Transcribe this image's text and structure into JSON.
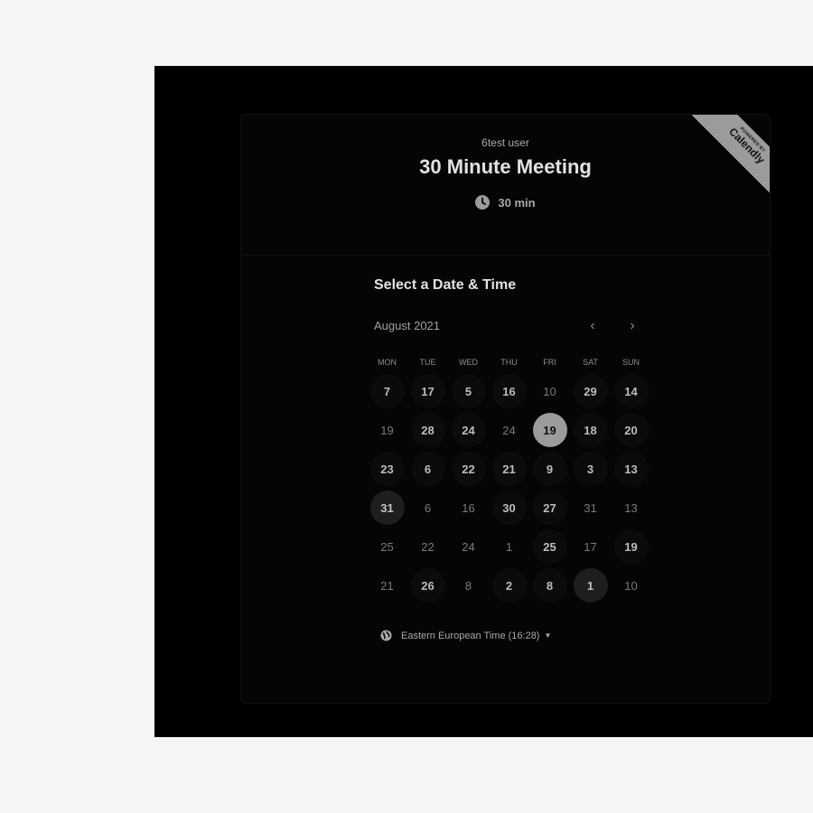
{
  "event": {
    "host": "6test user",
    "title": "30 Minute Meeting",
    "duration": "30 min"
  },
  "badge": {
    "top_text": "POWERED BY",
    "brand": "Calendly"
  },
  "picker": {
    "title": "Select a Date & Time",
    "month": "August 2021",
    "prev_icon": "chevron-left-icon",
    "next_icon": "chevron-right-icon",
    "weekdays": [
      "MON",
      "TUE",
      "WED",
      "THU",
      "FRI",
      "SAT",
      "SUN"
    ],
    "weeks": [
      [
        {
          "d": "7",
          "s": "avail"
        },
        {
          "d": "17",
          "s": "avail"
        },
        {
          "d": "5",
          "s": "avail"
        },
        {
          "d": "16",
          "s": "avail"
        },
        {
          "d": "10",
          "s": "off"
        },
        {
          "d": "29",
          "s": "avail"
        },
        {
          "d": "14",
          "s": "avail"
        }
      ],
      [
        {
          "d": "19",
          "s": "off"
        },
        {
          "d": "28",
          "s": "avail"
        },
        {
          "d": "24",
          "s": "avail"
        },
        {
          "d": "24",
          "s": "off"
        },
        {
          "d": "19",
          "s": "selected"
        },
        {
          "d": "18",
          "s": "avail"
        },
        {
          "d": "20",
          "s": "avail"
        }
      ],
      [
        {
          "d": "23",
          "s": "avail"
        },
        {
          "d": "6",
          "s": "avail"
        },
        {
          "d": "22",
          "s": "avail"
        },
        {
          "d": "21",
          "s": "avail"
        },
        {
          "d": "9",
          "s": "avail"
        },
        {
          "d": "3",
          "s": "avail"
        },
        {
          "d": "13",
          "s": "avail"
        }
      ],
      [
        {
          "d": "31",
          "s": "soft"
        },
        {
          "d": "6",
          "s": "off"
        },
        {
          "d": "16",
          "s": "off"
        },
        {
          "d": "30",
          "s": "avail"
        },
        {
          "d": "27",
          "s": "avail"
        },
        {
          "d": "31",
          "s": "off"
        },
        {
          "d": "13",
          "s": "off"
        }
      ],
      [
        {
          "d": "25",
          "s": "off"
        },
        {
          "d": "22",
          "s": "off"
        },
        {
          "d": "24",
          "s": "off"
        },
        {
          "d": "1",
          "s": "off"
        },
        {
          "d": "25",
          "s": "avail"
        },
        {
          "d": "17",
          "s": "off"
        },
        {
          "d": "19",
          "s": "avail"
        }
      ],
      [
        {
          "d": "21",
          "s": "off"
        },
        {
          "d": "26",
          "s": "avail"
        },
        {
          "d": "8",
          "s": "off"
        },
        {
          "d": "2",
          "s": "avail"
        },
        {
          "d": "8",
          "s": "avail"
        },
        {
          "d": "1",
          "s": "soft"
        },
        {
          "d": "10",
          "s": "off"
        }
      ]
    ],
    "timezone": "Eastern European Time (16:28)"
  },
  "colors": {
    "page_bg": "#f5f5f5",
    "frame_bg": "#000000",
    "selected": "#9b9b9b"
  }
}
